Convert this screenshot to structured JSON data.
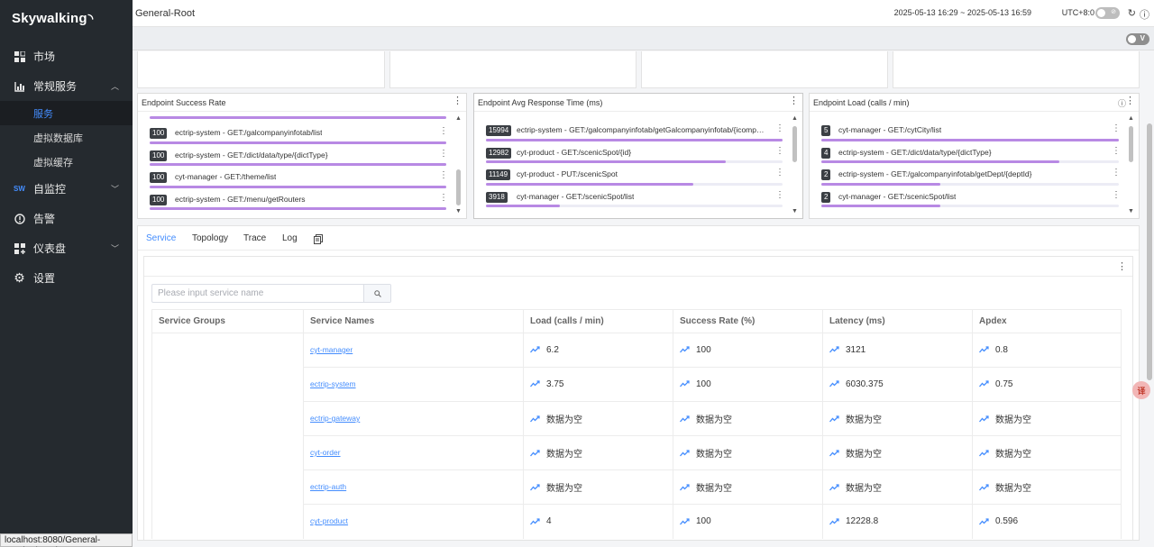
{
  "app": {
    "logo": "Skywalking"
  },
  "sidebar": {
    "items": [
      {
        "label": "市场",
        "icon": "market-icon"
      },
      {
        "label": "常规服务",
        "icon": "chart-icon",
        "expanded": true,
        "children": [
          {
            "label": "服务",
            "active": true
          },
          {
            "label": "虚拟数据库"
          },
          {
            "label": "虚拟缓存"
          }
        ]
      },
      {
        "label": "自监控",
        "icon": "sw-icon"
      },
      {
        "label": "告警",
        "icon": "alert-icon"
      },
      {
        "label": "仪表盘",
        "icon": "dashboard-icon"
      },
      {
        "label": "设置",
        "icon": "gear-icon"
      }
    ],
    "status_url": "localhost:8080/General-Service/Services"
  },
  "header": {
    "title": "General-Root",
    "time_range": "2025-05-13 16:29 ~ 2025-05-13 16:59",
    "timezone": "UTC+8:0"
  },
  "widgets": {
    "success_rate": {
      "title": "Endpoint Success Rate",
      "items": [
        {
          "value": "100",
          "label": "ectrip-system - GET:/galcompanyinfotab/list",
          "pct": 100
        },
        {
          "value": "100",
          "label": "ectrip-system - GET:/dict/data/type/{dictType}",
          "pct": 100
        },
        {
          "value": "100",
          "label": "cyt-manager - GET:/theme/list",
          "pct": 100
        },
        {
          "value": "100",
          "label": "ectrip-system - GET:/menu/getRouters",
          "pct": 100
        }
      ]
    },
    "avg_response": {
      "title": "Endpoint Avg Response Time (ms)",
      "items": [
        {
          "value": "15994",
          "label": "ectrip-system - GET:/galcompanyinfotab/getGalcompanyinfotab/{icompanyi...",
          "pct": 100
        },
        {
          "value": "12982",
          "label": "cyt-product - GET:/scenicSpot/{id}",
          "pct": 81
        },
        {
          "value": "11149",
          "label": "cyt-product - PUT:/scenicSpot",
          "pct": 70
        },
        {
          "value": "3918",
          "label": "cyt-manager - GET:/scenicSpot/list",
          "pct": 25
        }
      ]
    },
    "load": {
      "title": "Endpoint Load (calls / min)",
      "items": [
        {
          "value": "5",
          "label": "cyt-manager - GET:/cytCity/list",
          "pct": 100
        },
        {
          "value": "4",
          "label": "ectrip-system - GET:/dict/data/type/{dictType}",
          "pct": 80
        },
        {
          "value": "2",
          "label": "ectrip-system - GET:/galcompanyinfotab/getDept/{deptId}",
          "pct": 40
        },
        {
          "value": "2",
          "label": "cyt-manager - GET:/scenicSpot/list",
          "pct": 40
        }
      ]
    }
  },
  "tabs": [
    {
      "label": "Service",
      "active": true
    },
    {
      "label": "Topology"
    },
    {
      "label": "Trace"
    },
    {
      "label": "Log"
    }
  ],
  "services": {
    "search_placeholder": "Please input service name",
    "columns": [
      "Service Groups",
      "Service Names",
      "Load (calls / min)",
      "Success Rate (%)",
      "Latency (ms)",
      "Apdex"
    ],
    "rows": [
      {
        "name": "cyt-manager",
        "load": "6.2",
        "success": "100",
        "latency": "3121",
        "apdex": "0.8"
      },
      {
        "name": "ectrip-system",
        "load": "3.75",
        "success": "100",
        "latency": "6030.375",
        "apdex": "0.75"
      },
      {
        "name": "ectrip-gateway",
        "load": "数据为空",
        "success": "数据为空",
        "latency": "数据为空",
        "apdex": "数据为空"
      },
      {
        "name": "cyt-order",
        "load": "数据为空",
        "success": "数据为空",
        "latency": "数据为空",
        "apdex": "数据为空"
      },
      {
        "name": "ectrip-auth",
        "load": "数据为空",
        "success": "数据为空",
        "latency": "数据为空",
        "apdex": "数据为空"
      },
      {
        "name": "cyt-product",
        "load": "4",
        "success": "100",
        "latency": "12228.8",
        "apdex": "0.596"
      }
    ]
  },
  "colors": {
    "accent": "#448dfe",
    "bar": "#b889e4",
    "sidebar": "#252a2f"
  }
}
